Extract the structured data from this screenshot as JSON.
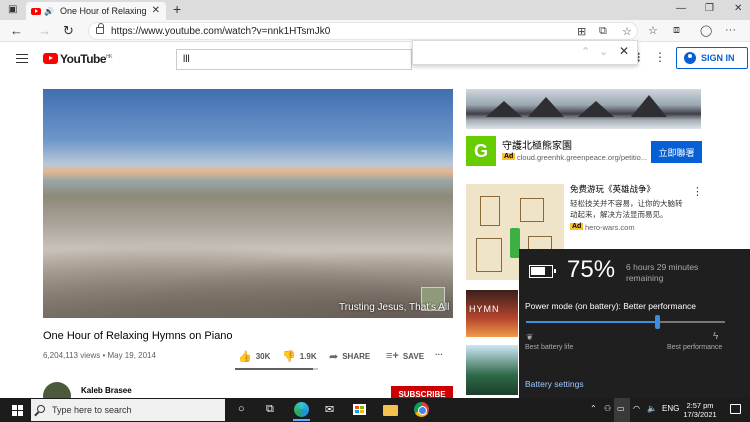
{
  "browser": {
    "tab_title": "One Hour of Relaxing Hymns o",
    "tab_close": "✕",
    "new_tab": "+",
    "url": "https://www.youtube.com/watch?v=nnk1HTsmJk0",
    "window_min": "—",
    "window_max": "❐",
    "window_close": "✕"
  },
  "youtube": {
    "logo_text": "YouTube",
    "region": "HK",
    "search_value": "lll",
    "sign_in": "SIGN IN"
  },
  "findbar": {
    "value": "",
    "prev": "⌃",
    "next": "⌄",
    "close": "✕"
  },
  "video": {
    "caption": "Trusting Jesus, That's All",
    "title": "One Hour of Relaxing Hymns on Piano",
    "meta": "6,204,113 views • May 19, 2014",
    "likes": "30K",
    "dislikes": "1.9K",
    "share": "SHARE",
    "save": "SAVE",
    "more": "···",
    "like_ratio": 0.94
  },
  "channel": {
    "name": "Kaleb Brasee",
    "subscribe": "SUBSCRIBE"
  },
  "ads": [
    {
      "title": "守護北極熊家園",
      "badge": "Ad",
      "url": "cloud.greenhk.greenpeace.org/petitio...",
      "cta": "立即聯署",
      "logo_letter": "G"
    },
    {
      "title": "免费游玩《英雄战争》",
      "line1": "轻松技关并不容易，让你的大脑转",
      "line2": "动起来，解决方法显而易见。",
      "badge": "Ad",
      "url": "hero-wars.com"
    }
  ],
  "suggestions": [
    {
      "thumb_text": "HYMN"
    }
  ],
  "battery": {
    "percent": "75%",
    "remaining_line1": "6 hours 29 minutes",
    "remaining_line2": "remaining",
    "power_mode": "Power mode (on battery): Better performance",
    "left_label": "Best battery life",
    "right_label": "Best performance",
    "settings_link": "Battery settings",
    "slider_level": 0.66
  },
  "taskbar": {
    "search_placeholder": "Type here to search",
    "language": "ENG",
    "time": "2:57 pm",
    "date": "17/3/2021"
  }
}
